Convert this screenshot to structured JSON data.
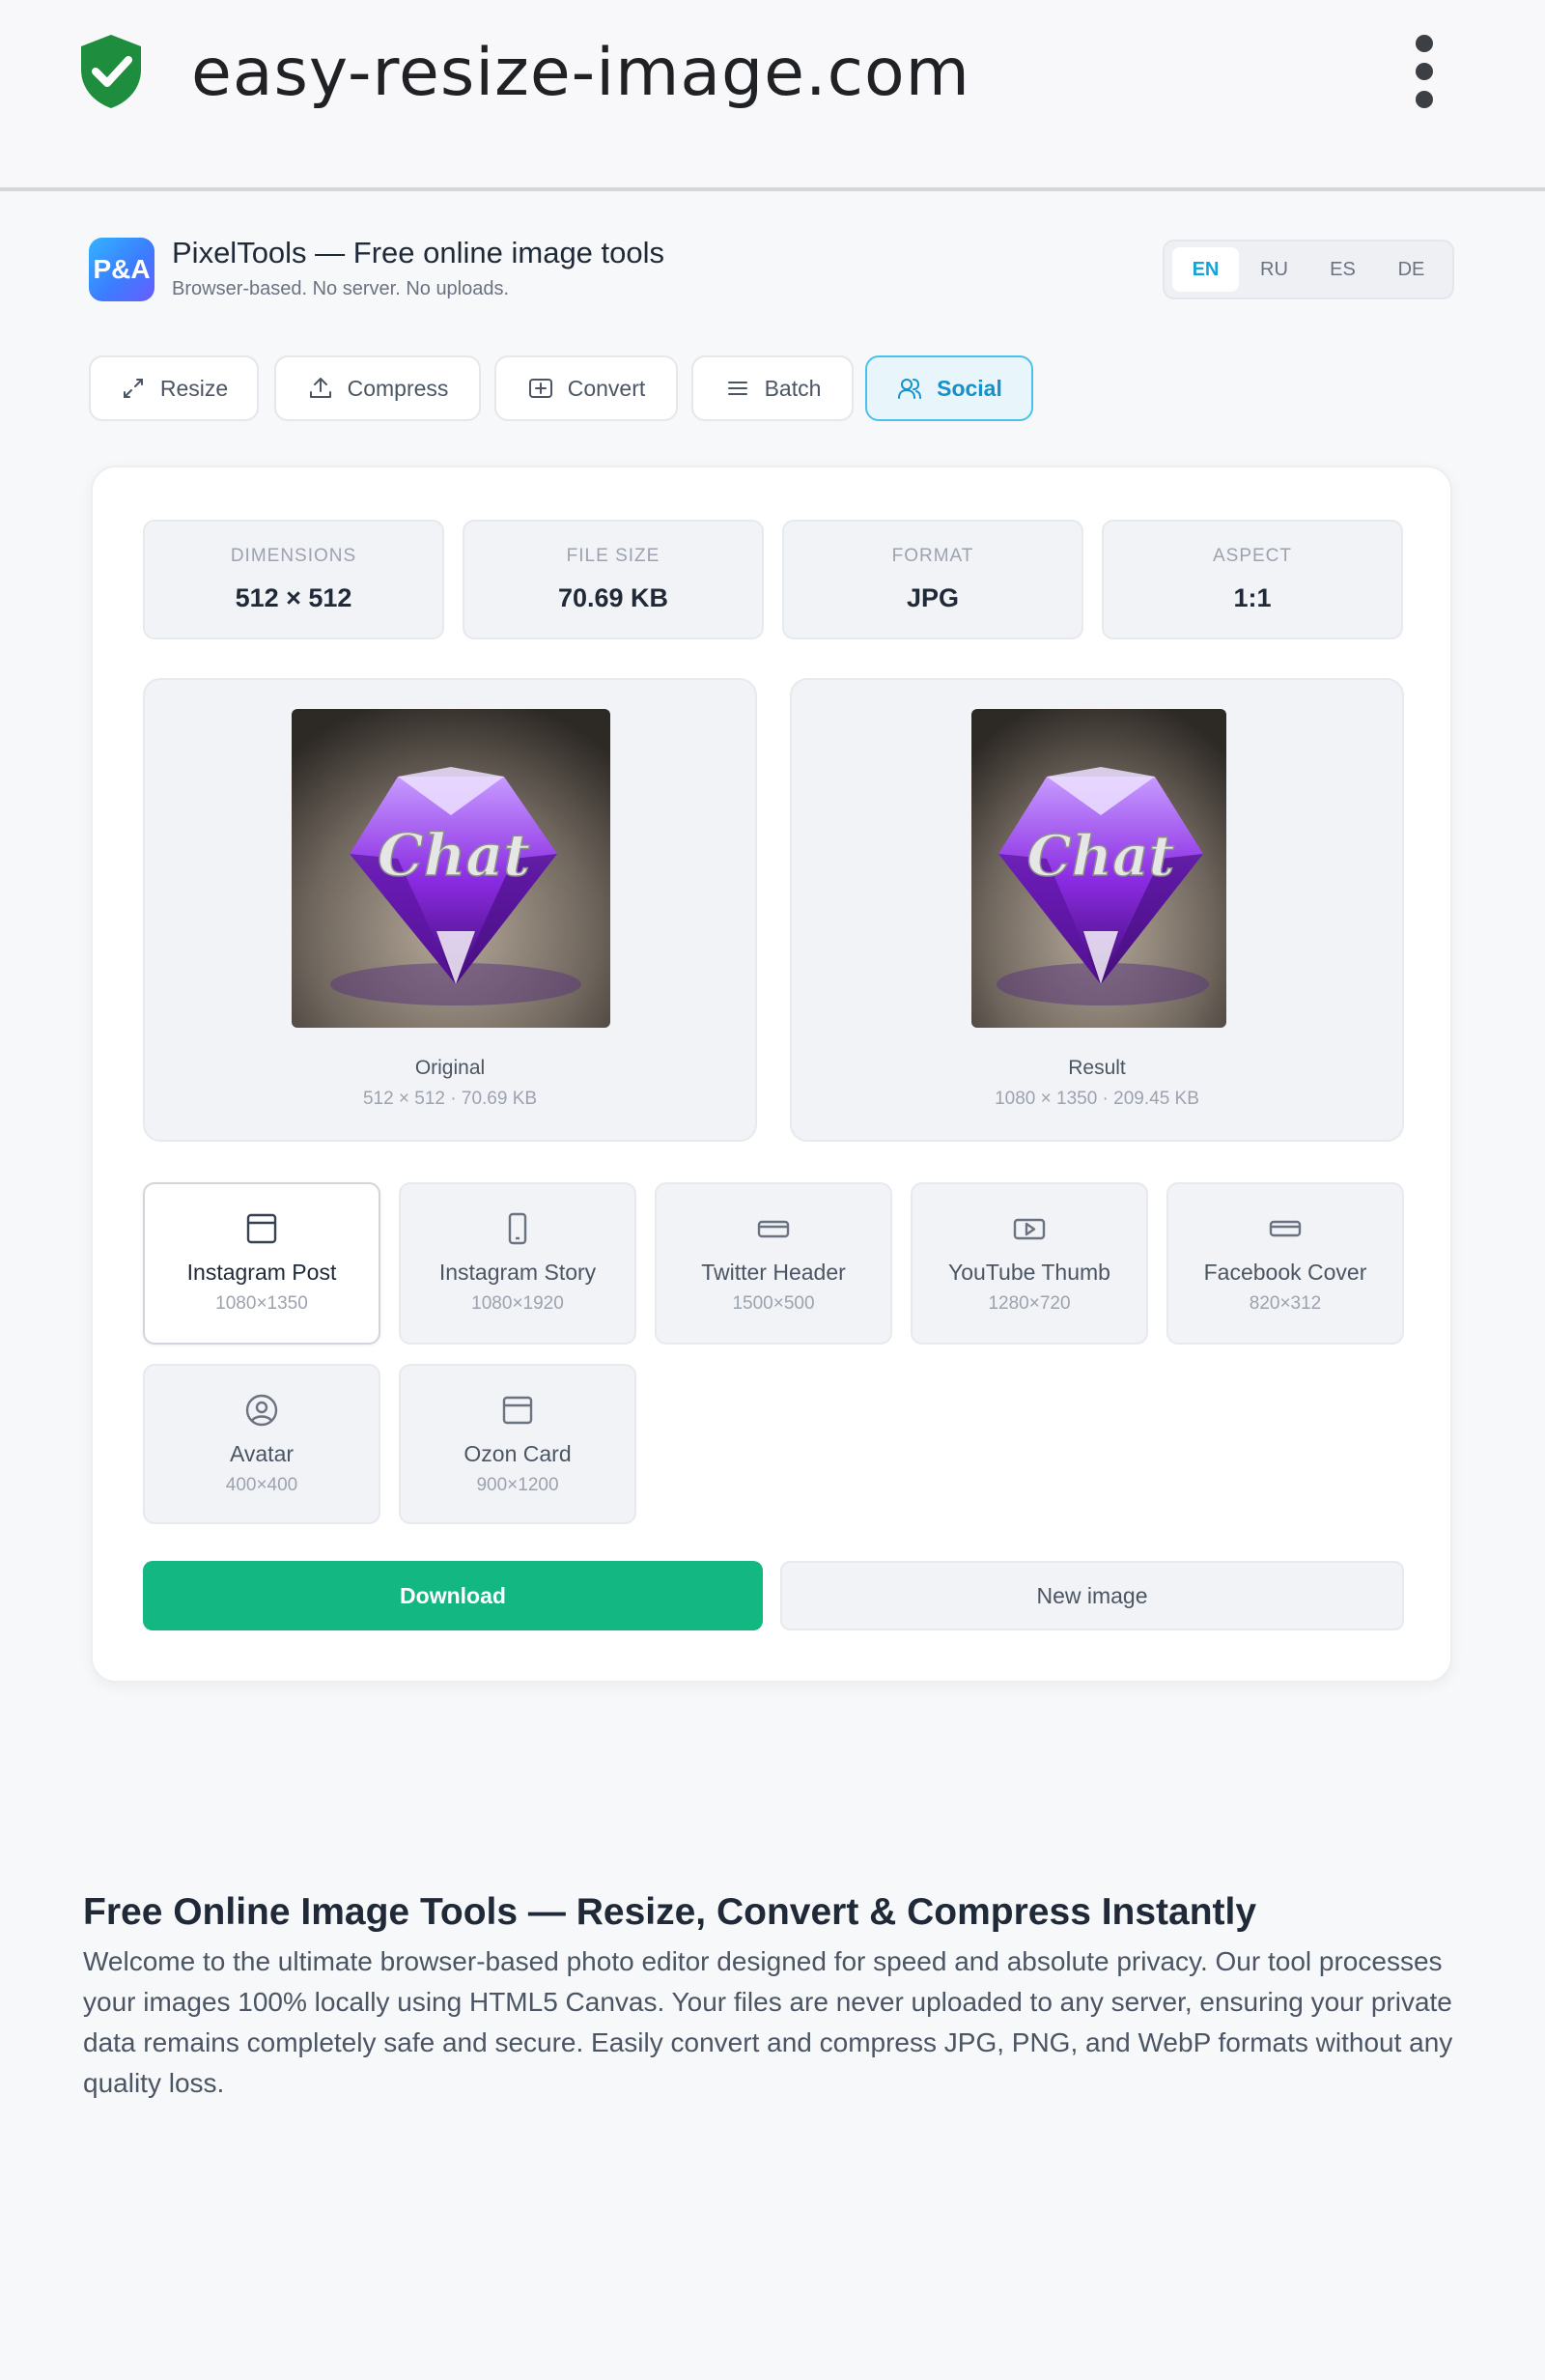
{
  "browser": {
    "url": "easy-resize-image.com",
    "shield_icon": "shield-check-icon",
    "menu_icon": "kebab-menu-icon",
    "shield_color": "#1e8e3e"
  },
  "app": {
    "logo_text": "P&A",
    "title": "PixelTools — Free online image tools",
    "subtitle": "Browser-based. No server. No uploads.",
    "accent_color": "#16a4d8"
  },
  "languages": {
    "selected": "EN",
    "items": [
      "EN",
      "RU",
      "ES",
      "DE"
    ]
  },
  "tabs": {
    "selected": "Social",
    "items": [
      {
        "label": "Resize",
        "icon": "expand-arrows-icon"
      },
      {
        "label": "Compress",
        "icon": "upload-icon"
      },
      {
        "label": "Convert",
        "icon": "plus-box-icon"
      },
      {
        "label": "Batch",
        "icon": "list-icon"
      },
      {
        "label": "Social",
        "icon": "users-icon"
      }
    ]
  },
  "stats": [
    {
      "label": "DIMENSIONS",
      "value": "512 × 512"
    },
    {
      "label": "FILE SIZE",
      "value": "70.69 KB"
    },
    {
      "label": "FORMAT",
      "value": "JPG"
    },
    {
      "label": "ASPECT",
      "value": "1:1"
    }
  ],
  "previews": {
    "original": {
      "caption": "Original",
      "meta": "512 × 512 · 70.69 KB",
      "image_text": "Chat"
    },
    "result": {
      "caption": "Result",
      "meta": "1080 × 1350 · 209.45 KB",
      "image_text": "Chat"
    }
  },
  "presets": {
    "selected": "Instagram Post",
    "items": [
      {
        "name": "Instagram Post",
        "size": "1080×1350",
        "icon": "square-post-icon"
      },
      {
        "name": "Instagram Story",
        "size": "1080×1920",
        "icon": "phone-icon"
      },
      {
        "name": "Twitter Header",
        "size": "1500×500",
        "icon": "banner-icon"
      },
      {
        "name": "YouTube Thumb",
        "size": "1280×720",
        "icon": "play-box-icon"
      },
      {
        "name": "Facebook Cover",
        "size": "820×312",
        "icon": "banner-icon"
      },
      {
        "name": "Avatar",
        "size": "400×400",
        "icon": "user-circle-icon"
      },
      {
        "name": "Ozon Card",
        "size": "900×1200",
        "icon": "card-icon"
      }
    ]
  },
  "actions": {
    "download": "Download",
    "new_image": "New image",
    "download_color": "#13b781"
  },
  "seo": {
    "title": "Free Online Image Tools — Resize, Convert & Compress Instantly",
    "text": "Welcome to the ultimate browser-based photo editor designed for speed and absolute privacy. Our tool processes your images 100% locally using HTML5 Canvas. Your files are never uploaded to any server, ensuring your private data remains completely safe and secure. Easily convert and compress JPG, PNG, and WebP formats without any quality loss."
  }
}
